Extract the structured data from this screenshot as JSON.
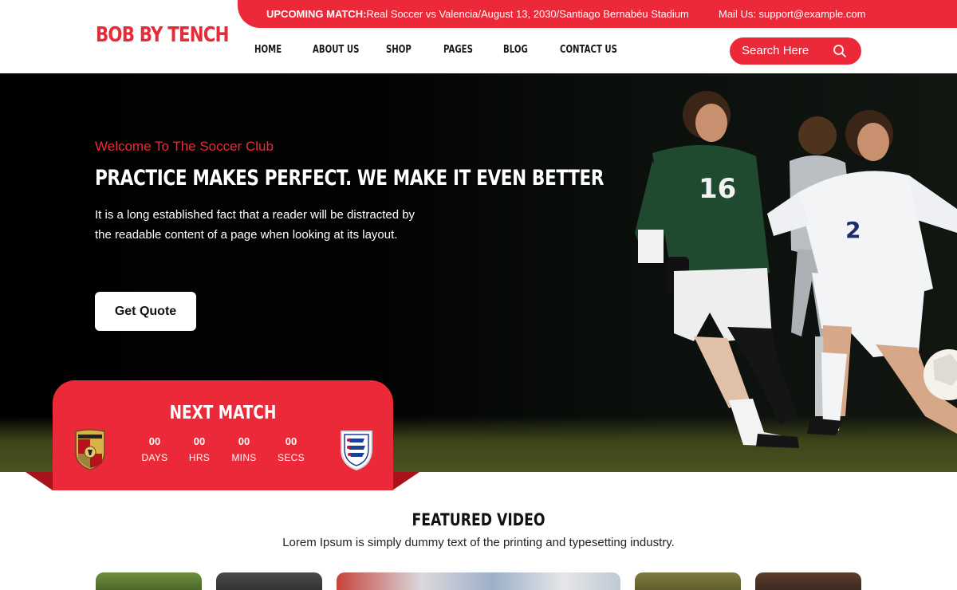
{
  "brand": {
    "logo": "BOB BY TENCH",
    "accent": "#ec2938"
  },
  "topbar": {
    "match_label": "UPCOMING MATCH:",
    "match_text": "Real Soccer vs Valencia/August 13, 2030/Santiago Bernabéu Stadium",
    "mail": "Mail Us: support@example.com"
  },
  "nav": {
    "items": [
      {
        "label": "HOME"
      },
      {
        "label": "ABOUT US"
      },
      {
        "label": "SHOP"
      },
      {
        "label": "PAGES"
      },
      {
        "label": "BLOG"
      },
      {
        "label": "CONTACT US"
      }
    ]
  },
  "search": {
    "placeholder": "Search Here",
    "icon": "search-icon"
  },
  "hero": {
    "welcome": "Welcome To The Soccer Club",
    "title": "PRACTICE MAKES PERFECT. WE MAKE IT EVEN BETTER",
    "text": "It is a long established fact that a reader will be distracted by the readable content of a page when looking at its layout.",
    "button": "Get Quote"
  },
  "next_match": {
    "title": "NEXT MATCH",
    "countdown": [
      {
        "value": "00",
        "label": "DAYS"
      },
      {
        "value": "00",
        "label": "HRS"
      },
      {
        "value": "00",
        "label": "MINS"
      },
      {
        "value": "00",
        "label": "SECS"
      }
    ],
    "home_crest": "porsche-crest-icon",
    "away_crest": "england-crest-icon"
  },
  "featured": {
    "title": "FEATURED VIDEO",
    "subtitle": "Lorem Ipsum is simply dummy text of the printing and typesetting industry."
  }
}
